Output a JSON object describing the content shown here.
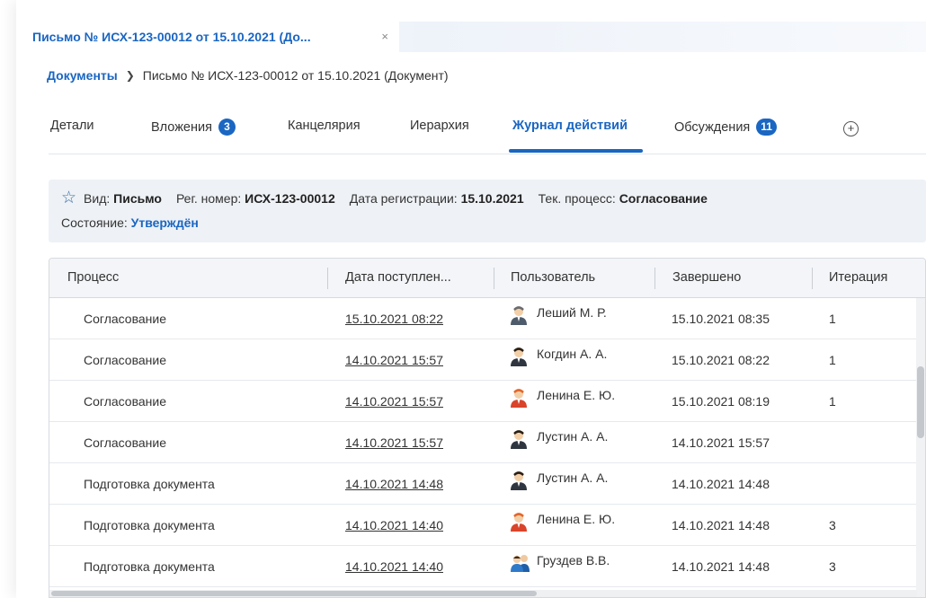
{
  "window_tab": {
    "title": "Письмо № ИСХ-123-00012 от 15.10.2021 (До...",
    "close": "×"
  },
  "breadcrumb": {
    "root": "Документы",
    "separator": "❯",
    "current": "Письмо № ИСХ-123-00012 от 15.10.2021 (Документ)"
  },
  "tabs": {
    "details": "Детали",
    "attachments": "Вложения",
    "attachments_count": "3",
    "office": "Канцелярия",
    "hierarchy": "Иерархия",
    "action_log": "Журнал действий",
    "discussions": "Обсуждения",
    "discussions_count": "11",
    "add": "+"
  },
  "info": {
    "kind_label": "Вид:",
    "kind_value": "Письмо",
    "reg_label": "Рег. номер:",
    "reg_value": "ИСХ-123-00012",
    "date_label": "Дата регистрации:",
    "date_value": "15.10.2021",
    "process_label": "Тек. процесс:",
    "process_value": "Согласование",
    "state_label": "Состояние:",
    "state_value": "Утверждён"
  },
  "table": {
    "columns": [
      "Процесс",
      "Дата поступлен...",
      "Пользователь",
      "Завершено",
      "Итерация"
    ],
    "rows": [
      {
        "process": "Согласование",
        "received": "15.10.2021 08:22",
        "user": "Леший М. Р.",
        "avatar": "male-grey",
        "completed": "15.10.2021 08:35",
        "iteration": "1"
      },
      {
        "process": "Согласование",
        "received": "14.10.2021 15:57",
        "user": "Когдин А. А.",
        "avatar": "male-dark",
        "completed": "15.10.2021 08:22",
        "iteration": "1"
      },
      {
        "process": "Согласование",
        "received": "14.10.2021 15:57",
        "user": "Ленина Е. Ю.",
        "avatar": "female-red",
        "completed": "15.10.2021 08:19",
        "iteration": "1"
      },
      {
        "process": "Согласование",
        "received": "14.10.2021 15:57",
        "user": "Лустин А. А.",
        "avatar": "male-dark",
        "completed": "14.10.2021 15:57",
        "iteration": ""
      },
      {
        "process": "Подготовка документа",
        "received": "14.10.2021 14:48",
        "user": "Лустин А. А.",
        "avatar": "male-dark",
        "completed": "14.10.2021 14:48",
        "iteration": ""
      },
      {
        "process": "Подготовка документа",
        "received": "14.10.2021 14:40",
        "user": "Ленина Е. Ю.",
        "avatar": "female-red",
        "completed": "14.10.2021 14:48",
        "iteration": "3"
      },
      {
        "process": "Подготовка документа",
        "received": "14.10.2021 14:40",
        "user": "Груздев В.В.",
        "avatar": "group-blue",
        "completed": "14.10.2021 14:48",
        "iteration": "3"
      }
    ]
  },
  "colors": {
    "accent": "#1a66c2",
    "panel": "#eef1f5",
    "header": "#f3f5f8"
  }
}
